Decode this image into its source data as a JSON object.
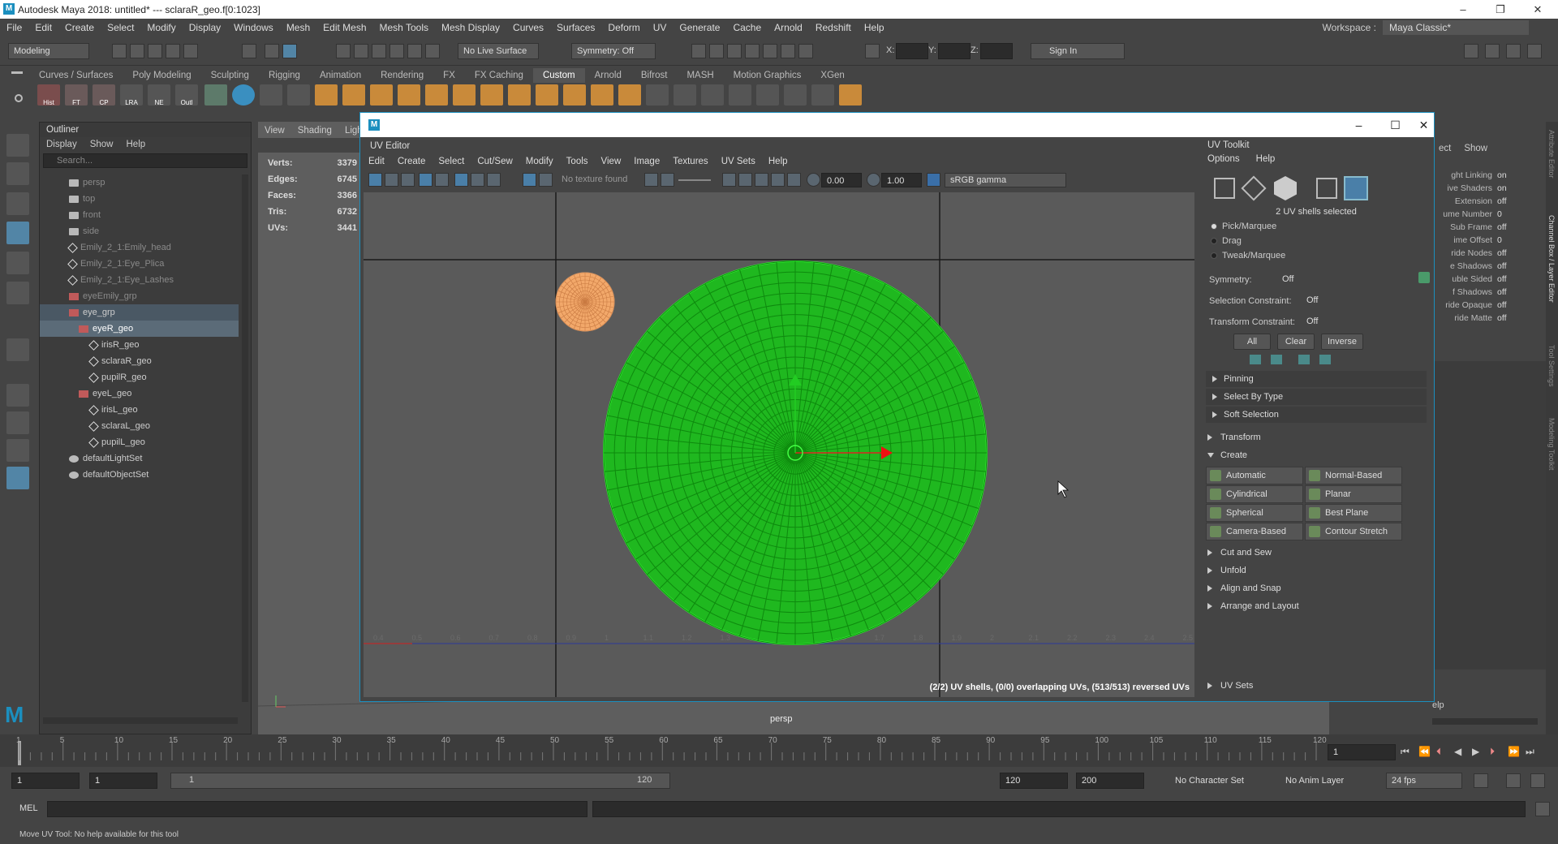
{
  "window": {
    "title": "Autodesk Maya 2018: untitled*   ---   sclaraR_geo.f[0:1023]"
  },
  "menus": [
    "File",
    "Edit",
    "Create",
    "Select",
    "Modify",
    "Display",
    "Windows",
    "Mesh",
    "Edit Mesh",
    "Mesh Tools",
    "Mesh Display",
    "Curves",
    "Surfaces",
    "Deform",
    "UV",
    "Generate",
    "Cache",
    "Arnold",
    "Redshift",
    "Help"
  ],
  "workspace": {
    "label": "Workspace :",
    "value": "Maya Classic*"
  },
  "status": {
    "mode": "Modeling",
    "live_surface": "No Live Surface",
    "symmetry": "Symmetry: Off",
    "x": "X:",
    "y": "Y:",
    "z": "Z:",
    "sign_in": "Sign In"
  },
  "shelf_tabs": [
    "Curves / Surfaces",
    "Poly Modeling",
    "Sculpting",
    "Rigging",
    "Animation",
    "Rendering",
    "FX",
    "FX Caching",
    "Custom",
    "Arnold",
    "Bifrost",
    "MASH",
    "Motion Graphics",
    "XGen"
  ],
  "shelf_active": "Custom",
  "shelf_icons": [
    "Hist",
    "FT",
    "CP",
    "LRA",
    "NE",
    "Outl"
  ],
  "outliner": {
    "title": "Outliner",
    "menu": [
      "Display",
      "Show",
      "Help"
    ],
    "search_placeholder": "Search...",
    "items": [
      {
        "label": "persp",
        "icon": "camera-icon"
      },
      {
        "label": "top",
        "icon": "camera-icon"
      },
      {
        "label": "front",
        "icon": "camera-icon"
      },
      {
        "label": "side",
        "icon": "camera-icon"
      },
      {
        "label": "Emily_2_1:Emily_head",
        "icon": "mesh-icon"
      },
      {
        "label": "Emily_2_1:Eye_Plica",
        "icon": "mesh-icon"
      },
      {
        "label": "Emily_2_1:Eye_Lashes",
        "icon": "mesh-icon"
      },
      {
        "label": "eyeEmily_grp",
        "icon": "group-icon"
      },
      {
        "label": "eye_grp",
        "icon": "group-icon"
      },
      {
        "label": "eyeR_geo",
        "icon": "group-icon"
      },
      {
        "label": "irisR_geo",
        "icon": "mesh-icon"
      },
      {
        "label": "sclaraR_geo",
        "icon": "mesh-icon"
      },
      {
        "label": "pupilR_geo",
        "icon": "mesh-icon"
      },
      {
        "label": "eyeL_geo",
        "icon": "group-icon"
      },
      {
        "label": "irisL_geo",
        "icon": "mesh-icon"
      },
      {
        "label": "sclaraL_geo",
        "icon": "mesh-icon"
      },
      {
        "label": "pupilL_geo",
        "icon": "mesh-icon"
      },
      {
        "label": "defaultLightSet",
        "icon": "set-icon"
      },
      {
        "label": "defaultObjectSet",
        "icon": "set-icon"
      }
    ]
  },
  "viewport": {
    "menu": [
      "View",
      "Shading",
      "Ligh"
    ],
    "stats": [
      {
        "k": "Verts:",
        "v": "3379"
      },
      {
        "k": "Edges:",
        "v": "6745"
      },
      {
        "k": "Faces:",
        "v": "3366"
      },
      {
        "k": "Tris:",
        "v": "6732"
      },
      {
        "k": "UVs:",
        "v": "3441"
      }
    ],
    "camera": "persp"
  },
  "uv_editor": {
    "title": "UV Editor",
    "menu": [
      "Edit",
      "Create",
      "Select",
      "Cut/Sew",
      "Modify",
      "Tools",
      "View",
      "Image",
      "Textures",
      "UV Sets",
      "Help"
    ],
    "texture": "No texture found",
    "exposure": "0.00",
    "gamma": "1.00",
    "colorspace": "sRGB gamma",
    "ruler": [
      "0.4",
      "0.5",
      "0.6",
      "0.7",
      "0.8",
      "0.9",
      "1",
      "1.1",
      "1.2",
      "1.3",
      "1.4",
      "1.5",
      "1.6",
      "1.7",
      "1.8",
      "1.9",
      "2",
      "2.1",
      "2.2",
      "2.3",
      "2.4",
      "2.5"
    ],
    "message": "(2/2) UV shells, (0/0) overlapping UVs, (513/513) reversed UVs"
  },
  "uv_toolkit": {
    "title": "UV Toolkit",
    "menu": [
      "Options",
      "Help"
    ],
    "selection_info": "2 UV shells selected",
    "modes": [
      "Pick/Marquee",
      "Drag",
      "Tweak/Marquee"
    ],
    "symmetry": {
      "label": "Symmetry:",
      "value": "Off"
    },
    "sel_constraint": {
      "label": "Selection Constraint:",
      "value": "Off"
    },
    "xf_constraint": {
      "label": "Transform Constraint:",
      "value": "Off"
    },
    "buttons": [
      "All",
      "Clear",
      "Inverse"
    ],
    "subsections": [
      "Pinning",
      "Select By Type",
      "Soft Selection"
    ],
    "transform": "Transform",
    "create": "Create",
    "create_buttons": [
      "Automatic",
      "Normal-Based",
      "Cylindrical",
      "Planar",
      "Spherical",
      "Best Plane",
      "Camera-Based",
      "Contour Stretch"
    ],
    "sections": [
      "Cut and Sew",
      "Unfold",
      "Align and Snap",
      "Arrange and Layout"
    ],
    "uv_sets": "UV Sets"
  },
  "channel_box": {
    "menu": [
      "ect",
      "Show"
    ],
    "rows": [
      {
        "k": "ght Linking",
        "v": "on"
      },
      {
        "k": "ive Shaders",
        "v": "on"
      },
      {
        "k": "Extension",
        "v": "off"
      },
      {
        "k": "ume Number",
        "v": "0"
      },
      {
        "k": "Sub Frame",
        "v": "off"
      },
      {
        "k": "ime Offset",
        "v": "0"
      },
      {
        "k": "ride Nodes",
        "v": "off"
      },
      {
        "k": "e Shadows",
        "v": "off"
      },
      {
        "k": "uble Sided",
        "v": "off"
      },
      {
        "k": "f Shadows",
        "v": "off"
      },
      {
        "k": "ride Opaque",
        "v": "off"
      },
      {
        "k": "ride Matte",
        "v": "off"
      }
    ],
    "help": "elp",
    "side_tabs": [
      "Attribute Editor",
      "Channel Box / Layer Editor",
      "Tool Settings",
      "Modeling Toolkit"
    ]
  },
  "timeline": {
    "ticks": [
      "1",
      "5",
      "10",
      "15",
      "20",
      "25",
      "30",
      "35",
      "40",
      "45",
      "50",
      "55",
      "60",
      "65",
      "70",
      "75",
      "80",
      "85",
      "90",
      "95",
      "100",
      "105",
      "110",
      "115",
      "120"
    ],
    "current": "1"
  },
  "range": {
    "start": "1",
    "inner_start": "1",
    "slider_start": "1",
    "slider_end": "120",
    "end": "120",
    "max": "200",
    "char_set": "No Character Set",
    "anim_layer": "No Anim Layer",
    "fps": "24 fps"
  },
  "mel": {
    "label": "MEL"
  },
  "help_line": "Move UV Tool: No help available for this tool"
}
